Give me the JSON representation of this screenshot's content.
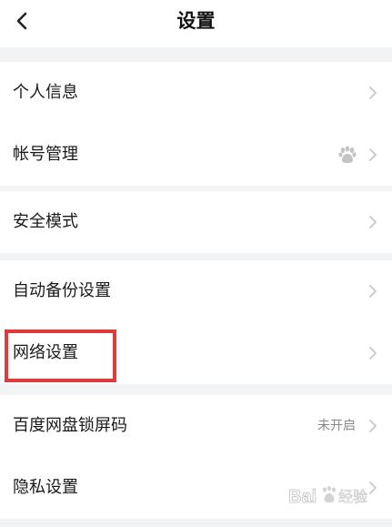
{
  "header": {
    "title": "设置",
    "back_icon": "chevron-left-icon"
  },
  "groups": [
    {
      "items": [
        {
          "label": "个人信息"
        },
        {
          "label": "帐号管理",
          "badge_icon": "paw-icon"
        }
      ]
    },
    {
      "items": [
        {
          "label": "安全模式"
        }
      ]
    },
    {
      "items": [
        {
          "label": "自动备份设置"
        },
        {
          "label": "网络设置",
          "highlighted": true
        }
      ]
    },
    {
      "items": [
        {
          "label": "百度网盘锁屏码",
          "value": "未开启"
        },
        {
          "label": "隐私设置"
        }
      ]
    }
  ],
  "annotation": {
    "highlight_color": "#e03a3a"
  },
  "watermark": {
    "text": "Bai 经验",
    "icon": "baidu-paw-icon"
  },
  "colors": {
    "background": "#f2f3f5",
    "surface": "#ffffff",
    "text": "#1a1a1a",
    "muted": "#888888",
    "chevron": "#c8c8c8"
  }
}
